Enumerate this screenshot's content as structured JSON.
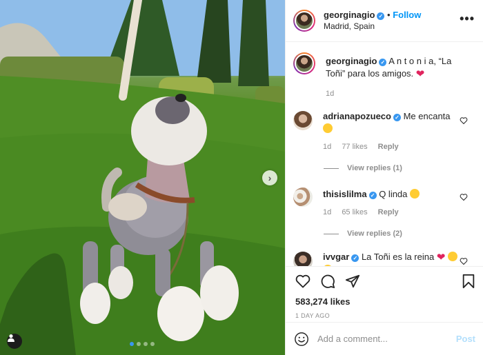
{
  "post": {
    "username": "georginagio",
    "follow_label": "Follow",
    "location": "Madrid, Spain",
    "more_label": "•••",
    "caption_text": "A n t o n i a, “La Toñi” para los amigos.",
    "caption_age": "1d",
    "likes": "583,274 likes",
    "posted_ago": "1 DAY AGO"
  },
  "comments": [
    {
      "username": "adrianapozueco",
      "text": "Me encanta",
      "age": "1d",
      "likes": "77 likes",
      "reply_label": "Reply",
      "view_replies": "View replies (1)"
    },
    {
      "username": "thisislilma",
      "text": "Q linda",
      "age": "1d",
      "likes": "65 likes",
      "reply_label": "Reply",
      "view_replies": "View replies (2)"
    },
    {
      "username": "ivvgar",
      "text": "La Toñi es la reina"
    }
  ],
  "add_comment": {
    "placeholder": "Add a comment...",
    "post_label": "Post"
  },
  "carousel": {
    "slide_count": 4,
    "active_index": 0,
    "next_label": "›"
  },
  "colors": {
    "accent": "#0095f6",
    "verified": "#3897f0",
    "heart": "#e0245e"
  },
  "icons": [
    "heart-icon",
    "comment-icon",
    "share-icon",
    "bookmark-icon",
    "emoji-icon",
    "user-tag-icon",
    "chevron-right-icon",
    "more-icon"
  ]
}
